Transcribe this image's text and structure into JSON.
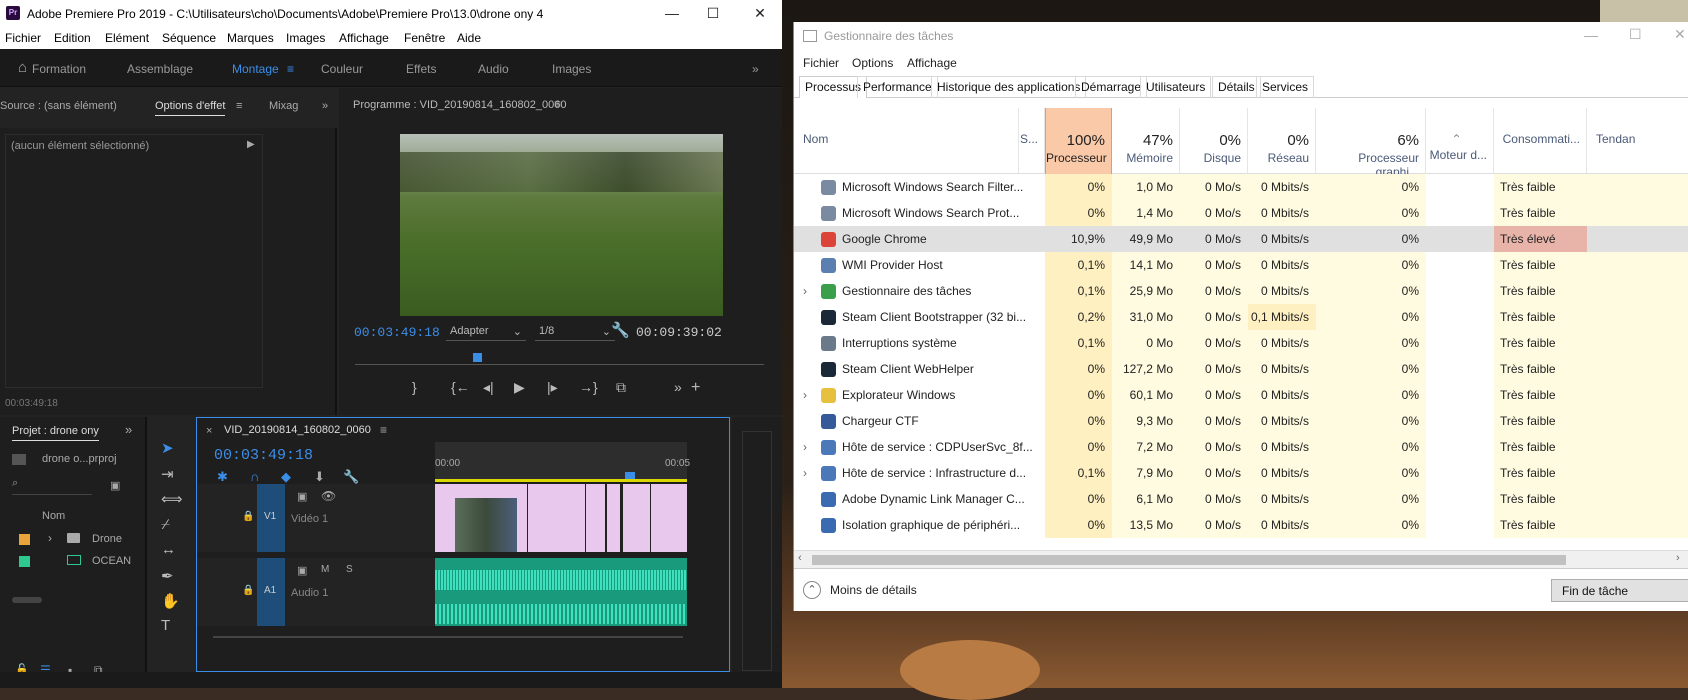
{
  "premiere": {
    "title": "Adobe Premiere Pro 2019 - C:\\Utilisateurs\\cho\\Documents\\Adobe\\Premiere Pro\\13.0\\drone ony 4",
    "logo": "Pr",
    "menu": [
      "Fichier",
      "Edition",
      "Elément",
      "Séquence",
      "Marques",
      "Images",
      "Affichage",
      "Fenêtre",
      "Aide"
    ],
    "workspaces": [
      "Formation",
      "Assemblage",
      "Montage",
      "Couleur",
      "Effets",
      "Audio",
      "Images"
    ],
    "active_workspace": "Montage",
    "source_tab": "Source : (sans élément)",
    "effect_tab": "Options d'effet",
    "mix_tab": "Mixag",
    "no_selection": "(aucun élément sélectionné)",
    "source_timecode": "00:03:49:18",
    "program_title": "Programme : VID_20190814_160802_0060",
    "program_timecode": "00:03:49:18",
    "fit": "Adapter",
    "resolution": "1/8",
    "duration": "00:09:39:02",
    "project_title": "Projet : drone ony",
    "project_file": "drone o...prproj",
    "project_col": "Nom",
    "project_items": [
      {
        "name": "Drone",
        "color": "#e8a33a"
      },
      {
        "name": "OCEAN",
        "color": "#2ec98f"
      }
    ],
    "sequence_tab": "VID_20190814_160802_0060",
    "timeline_timecode": "00:03:49:18",
    "ruler": [
      "00:00",
      "00:05"
    ],
    "video_track": {
      "id": "V1",
      "name": "Vidéo 1"
    },
    "audio_track": {
      "id": "A1",
      "name": "Audio 1"
    },
    "meter_labels": [
      "S",
      "S"
    ]
  },
  "taskmanager": {
    "title": "Gestionnaire des tâches",
    "menu": [
      "Fichier",
      "Options",
      "Affichage"
    ],
    "tabs": [
      "Processus",
      "Performance",
      "Historique des applications",
      "Démarrage",
      "Utilisateurs",
      "Détails",
      "Services"
    ],
    "active_tab": "Processus",
    "columns": [
      {
        "label": "Nom",
        "pct": ""
      },
      {
        "label": "S...",
        "pct": ""
      },
      {
        "label": "Processeur",
        "pct": "100%"
      },
      {
        "label": "Mémoire",
        "pct": "47%"
      },
      {
        "label": "Disque",
        "pct": "0%"
      },
      {
        "label": "Réseau",
        "pct": "0%"
      },
      {
        "label": "Processeur graphi...",
        "pct": "6%"
      },
      {
        "label": "Moteur d...",
        "pct": ""
      },
      {
        "label": "Consommati...",
        "pct": ""
      },
      {
        "label": "Tendan",
        "pct": ""
      }
    ],
    "processes": [
      {
        "name": "Microsoft Windows Search Filter...",
        "cpu": "0%",
        "mem": "1,0 Mo",
        "disk": "0 Mo/s",
        "net": "0 Mbits/s",
        "gpu": "0%",
        "power": "Très faible",
        "expand": false,
        "icon": "search-person-icon"
      },
      {
        "name": "Microsoft Windows Search Prot...",
        "cpu": "0%",
        "mem": "1,4 Mo",
        "disk": "0 Mo/s",
        "net": "0 Mbits/s",
        "gpu": "0%",
        "power": "Très faible",
        "expand": false,
        "icon": "search-person-icon"
      },
      {
        "name": "Google Chrome",
        "cpu": "10,9%",
        "mem": "49,9 Mo",
        "disk": "0 Mo/s",
        "net": "0 Mbits/s",
        "gpu": "0%",
        "power": "Très élevé",
        "expand": false,
        "icon": "chrome-icon"
      },
      {
        "name": "WMI Provider Host",
        "cpu": "0,1%",
        "mem": "14,1 Mo",
        "disk": "0 Mo/s",
        "net": "0 Mbits/s",
        "gpu": "0%",
        "power": "Très faible",
        "expand": false,
        "icon": "wmi-icon"
      },
      {
        "name": "Gestionnaire des tâches",
        "cpu": "0,1%",
        "mem": "25,9 Mo",
        "disk": "0 Mo/s",
        "net": "0 Mbits/s",
        "gpu": "0%",
        "power": "Très faible",
        "expand": true,
        "icon": "taskmgr-icon"
      },
      {
        "name": "Steam Client Bootstrapper (32 bi...",
        "cpu": "0,2%",
        "mem": "31,0 Mo",
        "disk": "0 Mo/s",
        "net": "0,1 Mbits/s",
        "gpu": "0%",
        "power": "Très faible",
        "expand": false,
        "icon": "steam-icon"
      },
      {
        "name": "Interruptions système",
        "cpu": "0,1%",
        "mem": "0 Mo",
        "disk": "0 Mo/s",
        "net": "0 Mbits/s",
        "gpu": "0%",
        "power": "Très faible",
        "expand": false,
        "icon": "cpu-icon"
      },
      {
        "name": "Steam Client WebHelper",
        "cpu": "0%",
        "mem": "127,2 Mo",
        "disk": "0 Mo/s",
        "net": "0 Mbits/s",
        "gpu": "0%",
        "power": "Très faible",
        "expand": false,
        "icon": "steam-icon"
      },
      {
        "name": "Explorateur Windows",
        "cpu": "0%",
        "mem": "60,1 Mo",
        "disk": "0 Mo/s",
        "net": "0 Mbits/s",
        "gpu": "0%",
        "power": "Très faible",
        "expand": true,
        "icon": "folder-icon"
      },
      {
        "name": "Chargeur CTF",
        "cpu": "0%",
        "mem": "9,3 Mo",
        "disk": "0 Mo/s",
        "net": "0 Mbits/s",
        "gpu": "0%",
        "power": "Très faible",
        "expand": false,
        "icon": "ctf-icon"
      },
      {
        "name": "Hôte de service : CDPUserSvc_8f...",
        "cpu": "0%",
        "mem": "7,2 Mo",
        "disk": "0 Mo/s",
        "net": "0 Mbits/s",
        "gpu": "0%",
        "power": "Très faible",
        "expand": true,
        "icon": "gear-icon"
      },
      {
        "name": "Hôte de service : Infrastructure d...",
        "cpu": "0,1%",
        "mem": "7,9 Mo",
        "disk": "0 Mo/s",
        "net": "0 Mbits/s",
        "gpu": "0%",
        "power": "Très faible",
        "expand": true,
        "icon": "gear-icon"
      },
      {
        "name": "Adobe Dynamic Link Manager C...",
        "cpu": "0%",
        "mem": "6,1 Mo",
        "disk": "0 Mo/s",
        "net": "0 Mbits/s",
        "gpu": "0%",
        "power": "Très faible",
        "expand": false,
        "icon": "app-icon"
      },
      {
        "name": "Isolation graphique de périphéri...",
        "cpu": "0%",
        "mem": "13,5 Mo",
        "disk": "0 Mo/s",
        "net": "0 Mbits/s",
        "gpu": "0%",
        "power": "Très faible",
        "expand": false,
        "icon": "app-icon"
      }
    ],
    "less_details": "Moins de détails",
    "end_task": "Fin de tâche",
    "colors": {
      "cpu_header": "#f9c9a8",
      "cpu_cell": "#fff0c2",
      "light_cell": "#fffbe0",
      "power_high": "#e8b3a8",
      "selected": "#e0e0e0"
    }
  }
}
